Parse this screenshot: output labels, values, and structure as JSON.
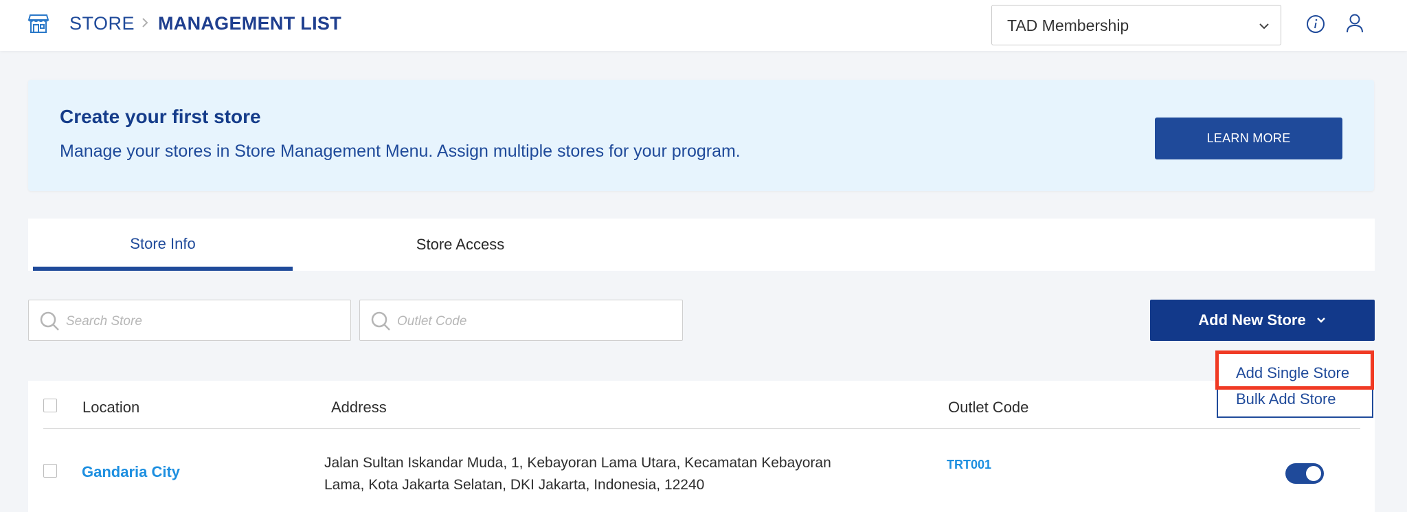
{
  "header": {
    "breadcrumb_root": "STORE",
    "breadcrumb_current": "MANAGEMENT LIST",
    "program_select": {
      "value": "TAD Membership"
    }
  },
  "banner": {
    "title": "Create your first store",
    "description": "Manage your stores in Store Management Menu. Assign multiple stores for your program.",
    "button_label": "LEARN MORE"
  },
  "tabs": [
    {
      "label": "Store Info",
      "active": true
    },
    {
      "label": "Store Access",
      "active": false
    }
  ],
  "search": {
    "store_placeholder": "Search Store",
    "outlet_placeholder": "Outlet Code"
  },
  "add_store": {
    "label": "Add New Store",
    "menu": [
      "Add Single Store",
      "Bulk Add Store"
    ],
    "highlighted_item": "Add Single Store"
  },
  "table": {
    "columns": [
      "Location",
      "Address",
      "Outlet Code"
    ],
    "rows": [
      {
        "location": "Gandaria City",
        "address": "Jalan Sultan Iskandar Muda, 1, Kebayoran Lama Utara, Kecamatan Kebayoran Lama, Kota Jakarta Selatan, DKI Jakarta, Indonesia, 12240",
        "outlet_code": "TRT001",
        "active": true
      }
    ]
  },
  "colors": {
    "primary": "#1f4a9a",
    "primary_dark": "#12398a",
    "link": "#1d8fe0",
    "banner_bg": "#e7f4fd",
    "highlight": "#f03a24"
  },
  "icons": [
    "store-icon",
    "chevron-right-icon",
    "chevron-down-icon",
    "info-icon",
    "user-icon",
    "search-icon"
  ]
}
